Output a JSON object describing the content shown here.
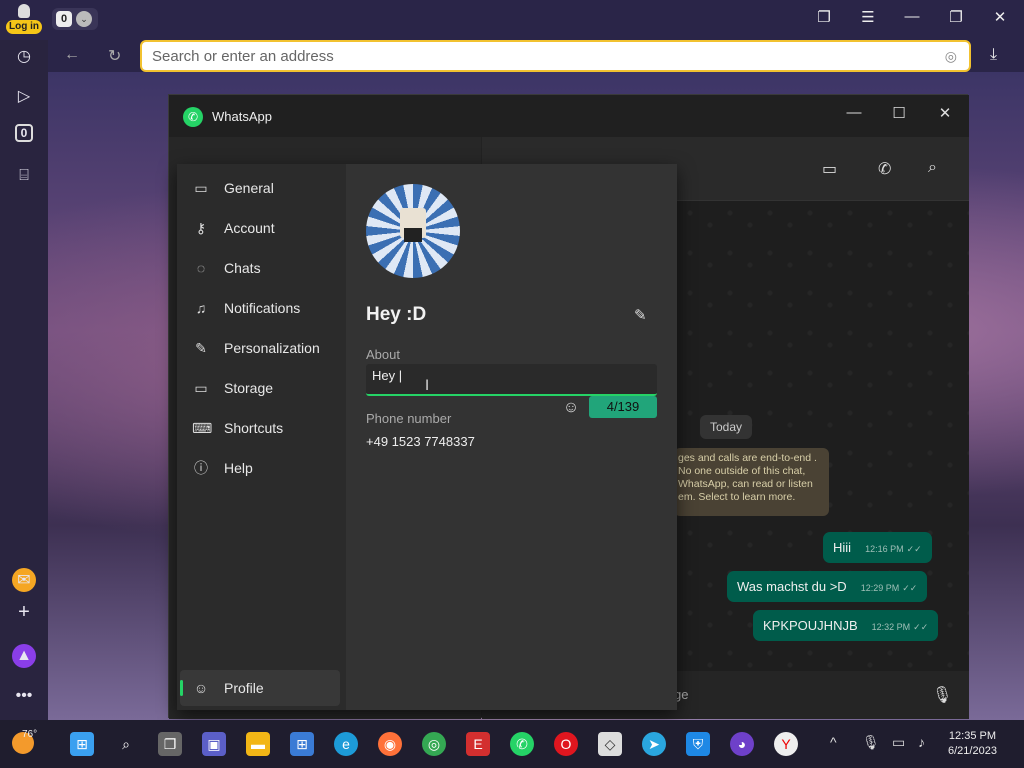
{
  "browser": {
    "login_label": "Log in",
    "tab_count": "0",
    "address_placeholder": "Search or enter an address",
    "sidebar_badge": "0"
  },
  "whatsapp": {
    "title": "WhatsApp",
    "chat": {
      "date_separator": "Today",
      "system_message": "ges and calls are end-to-end . No one outside of this chat, WhatsApp, can read or listen em. Select to learn more.",
      "messages": [
        {
          "text": "Hiii",
          "time": "12:16 PM"
        },
        {
          "text": "Was machst du >D",
          "time": "12:29 PM"
        },
        {
          "text": "KPKPOUJHNJB",
          "time": "12:32 PM"
        }
      ],
      "composer_fragment": "ge"
    },
    "settings": {
      "nav": [
        {
          "label": "General",
          "icon": "laptop-icon"
        },
        {
          "label": "Account",
          "icon": "key-icon"
        },
        {
          "label": "Chats",
          "icon": "chat-icon"
        },
        {
          "label": "Notifications",
          "icon": "bell-icon"
        },
        {
          "label": "Personalization",
          "icon": "brush-icon"
        },
        {
          "label": "Storage",
          "icon": "storage-icon"
        },
        {
          "label": "Shortcuts",
          "icon": "keyboard-icon"
        },
        {
          "label": "Help",
          "icon": "info-icon"
        }
      ],
      "profile_nav_label": "Profile",
      "profile": {
        "name": "Hey :D",
        "about_label": "About",
        "about_value": "Hey |",
        "char_counter": "4/139",
        "phone_label": "Phone number",
        "phone_value": "+49 1523 7748337"
      }
    }
  },
  "taskbar": {
    "weather": "76°",
    "time": "12:35 PM",
    "date": "6/21/2023"
  }
}
